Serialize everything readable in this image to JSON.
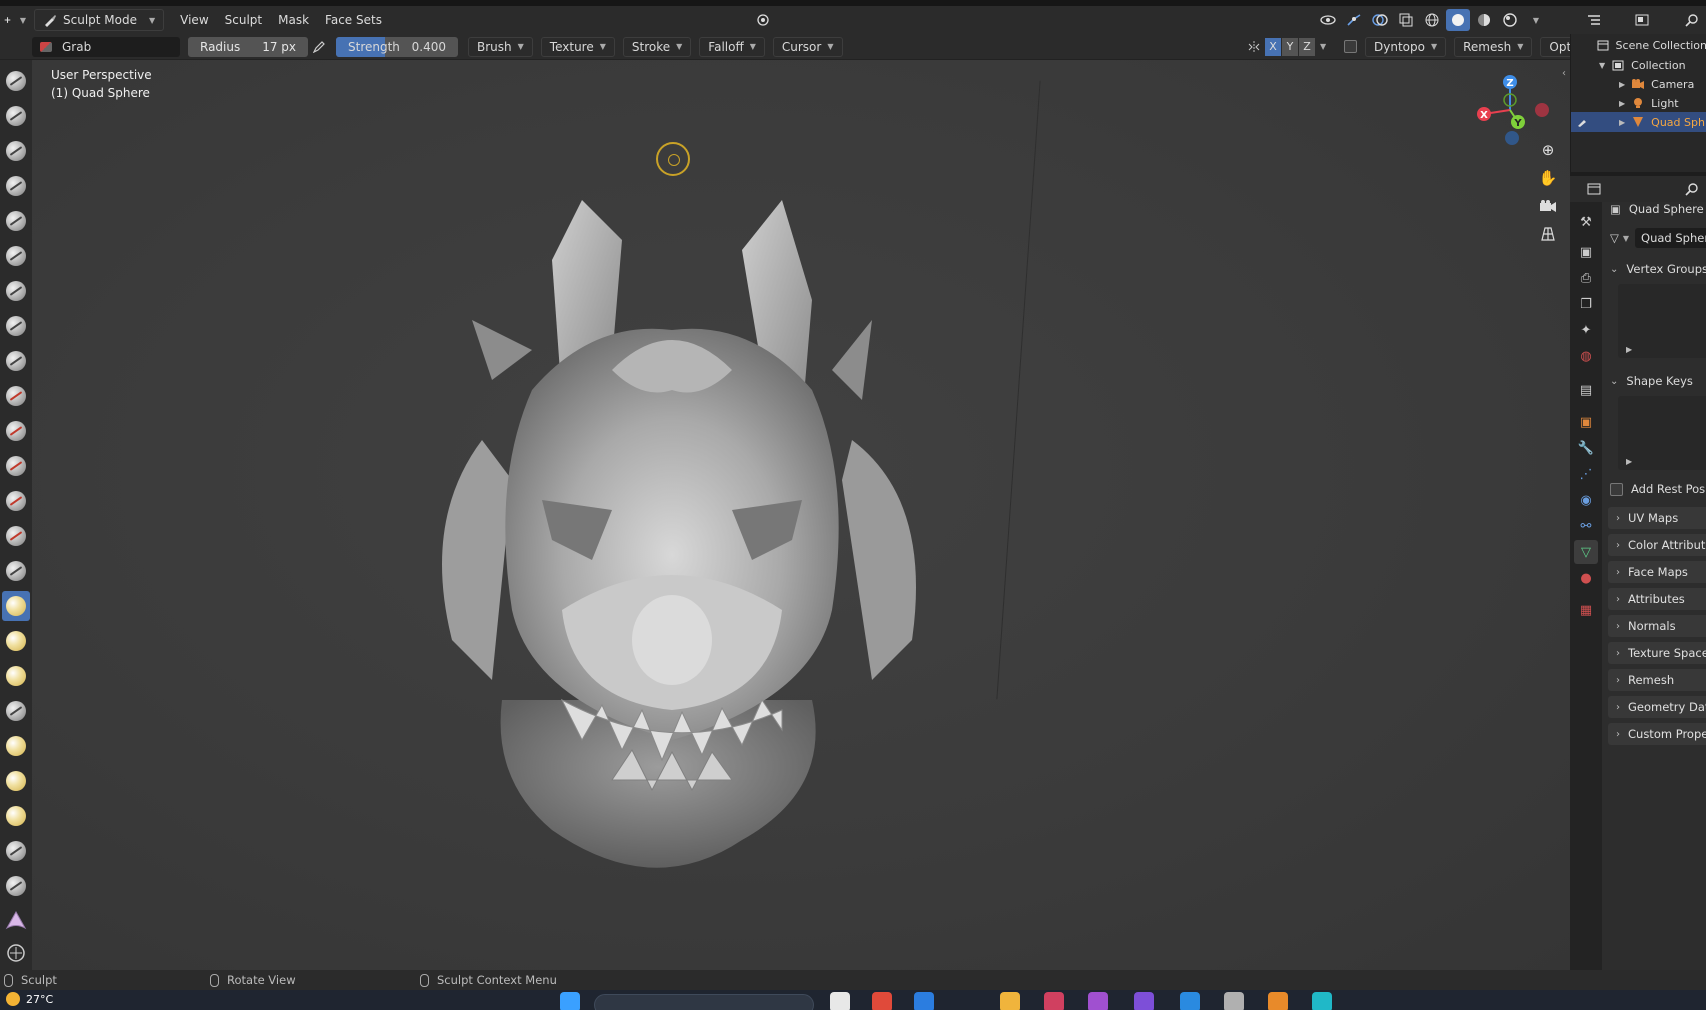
{
  "header": {
    "mode": "Sculpt Mode",
    "menus": [
      "View",
      "Sculpt",
      "Mask",
      "Face Sets"
    ]
  },
  "tool_settings": {
    "brush_name": "Grab",
    "radius_label": "Radius",
    "radius_value": "17 px",
    "strength_label": "Strength",
    "strength_value": "0.400",
    "strength_fraction": 0.4,
    "dropdowns": [
      "Brush",
      "Texture",
      "Stroke",
      "Falloff",
      "Cursor"
    ],
    "symmetry_axes": [
      "X",
      "Y",
      "Z"
    ],
    "dyntopo_label": "Dyntopo",
    "remesh_label": "Remesh",
    "options_label": "Options"
  },
  "viewport": {
    "perspective_label": "User Perspective",
    "object_label": "(1) Quad Sphere",
    "gizmo_axes": {
      "z": "Z",
      "y": "Y",
      "x": "X"
    },
    "colors": {
      "x_axis": "#e8404f",
      "y_axis": "#7fd03a",
      "z_axis": "#3f8ee8",
      "cursor": "#c9a227"
    }
  },
  "outliner": {
    "scene_collection": "Scene Collection",
    "collection": "Collection",
    "items": [
      {
        "name": "Camera",
        "icon": "camera-icon"
      },
      {
        "name": "Light",
        "icon": "light-icon"
      },
      {
        "name": "Quad Sph",
        "icon": "mesh-icon",
        "selected": true
      }
    ]
  },
  "properties": {
    "object_name": "Quad Sphere",
    "mesh_name": "Quad Spher",
    "vertex_groups": "Vertex Groups",
    "shape_keys": "Shape Keys",
    "add_rest_position": "Add Rest Positi",
    "panels": [
      "UV Maps",
      "Color Attributes",
      "Face Maps",
      "Attributes",
      "Normals",
      "Texture Space",
      "Remesh",
      "Geometry Data",
      "Custom Propert"
    ]
  },
  "statusbar": {
    "left": "Sculpt",
    "middle": "Rotate View",
    "right": "Sculpt Context Menu"
  },
  "taskbar": {
    "temperature": "27°C"
  }
}
